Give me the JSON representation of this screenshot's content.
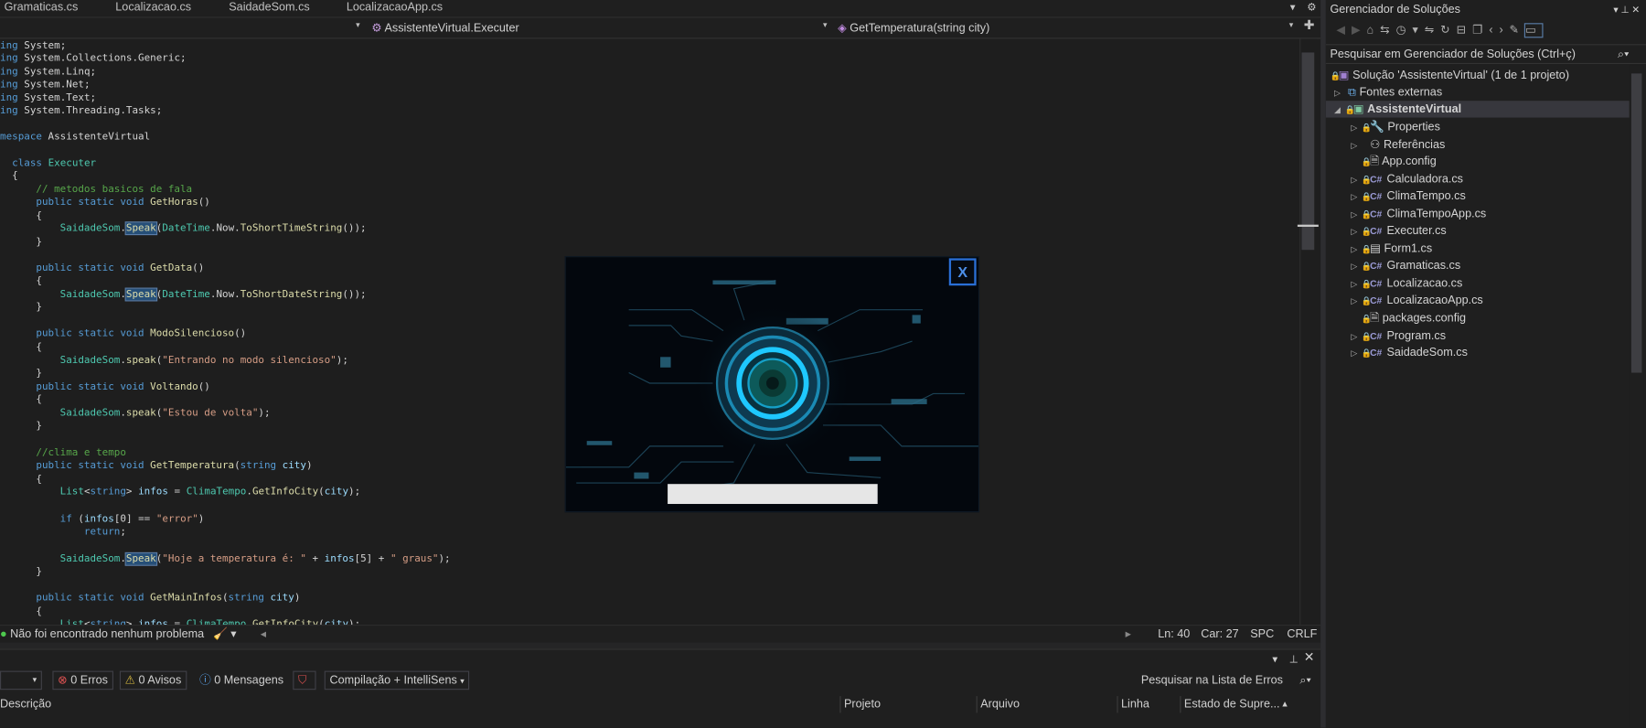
{
  "tabs": [
    {
      "label": "Gramaticas.cs"
    },
    {
      "label": "Localizacao.cs"
    },
    {
      "label": "SaidadeSom.cs"
    },
    {
      "label": "LocalizacaoApp.cs"
    }
  ],
  "tab_icons": {
    "dropdown": "▾",
    "settings": "⚙"
  },
  "navbar": {
    "class": "AssistenteVirtual.Executer",
    "method": "GetTemperatura(string city)"
  },
  "code": [
    {
      "kind": "using",
      "text": "ing System;"
    },
    {
      "kind": "using",
      "text": "ing System.Collections.Generic;"
    },
    {
      "kind": "using",
      "text": "ing System.Linq;"
    },
    {
      "kind": "using",
      "text": "ing System.Net;"
    },
    {
      "kind": "using",
      "text": "ing System.Text;"
    },
    {
      "kind": "using",
      "text": "ing System.Threading.Tasks;"
    },
    {
      "kind": "ns",
      "text": "mespace AssistenteVirtual"
    },
    {
      "kind": "class",
      "text": "class Executer"
    },
    {
      "kind": "comment",
      "text": "// metodos basicos de fala"
    },
    {
      "kind": "sig",
      "text": "public static void GetHoras()"
    },
    {
      "kind": "speak",
      "text": "SaidadeSom.Speak(DateTime.Now.ToShortTimeString());"
    },
    {
      "kind": "sig",
      "text": "public static void GetData()"
    },
    {
      "kind": "speak",
      "text": "SaidadeSom.Speak(DateTime.Now.ToShortDateString());"
    },
    {
      "kind": "sig",
      "text": "public static void ModoSilencioso()"
    },
    {
      "kind": "speak",
      "text": "SaidadeSom.speak(\"Entrando no modo silencioso\");"
    },
    {
      "kind": "sig",
      "text": "public static void Voltando()"
    },
    {
      "kind": "speak",
      "text": "SaidadeSom.speak(\"Estou de volta\");"
    },
    {
      "kind": "comment",
      "text": "//clima e tempo"
    },
    {
      "kind": "sig",
      "text": "public static void GetTemperatura(string city)"
    },
    {
      "kind": "stmt",
      "text": "List<string> infos = ClimaTempo.GetInfoCity(city);"
    },
    {
      "kind": "stmt",
      "text": "if (infos[0] == \"error\")"
    },
    {
      "kind": "stmt",
      "text": "return;"
    },
    {
      "kind": "speak",
      "text": "SaidadeSom.Speak(\"Hoje a temperatura é: \" + infos[5] + \" graus\");"
    },
    {
      "kind": "sig",
      "text": "public static void GetMainInfos(string city)"
    },
    {
      "kind": "stmt",
      "text": "List<string> infos = ClimaTempo.GetInfoCity(city);"
    },
    {
      "kind": "brace",
      "text": "{"
    },
    {
      "kind": "brace",
      "text": "}"
    }
  ],
  "status": {
    "problems": "Não foi encontrado nenhum problema",
    "line": "Ln: 40",
    "col": "Car: 27",
    "spacing": "SPC",
    "eol": "CRLF"
  },
  "errors": {
    "errors": "0 Erros",
    "warnings": "0 Avisos",
    "messages": "0 Mensagens",
    "scope": "Compilação + IntelliSens",
    "search": "Pesquisar na Lista de Erros",
    "columns": [
      "Descrição",
      "Projeto",
      "Arquivo",
      "Linha",
      "Estado de Supre..."
    ]
  },
  "solution": {
    "title": "Gerenciador de Soluções",
    "search": "Pesquisar em Gerenciador de Soluções (Ctrl+ç)",
    "root": "Solução 'AssistenteVirtual' (1 de 1 projeto)",
    "external": "Fontes externas",
    "project": "AssistenteVirtual",
    "items": [
      {
        "label": "Properties",
        "icon": "wrench-icon"
      },
      {
        "label": "Referências",
        "icon": "references-icon"
      },
      {
        "label": "App.config",
        "icon": "config-icon"
      },
      {
        "label": "Calculadora.cs",
        "icon": "csharp-icon"
      },
      {
        "label": "ClimaTempo.cs",
        "icon": "csharp-icon"
      },
      {
        "label": "ClimaTempoApp.cs",
        "icon": "csharp-icon"
      },
      {
        "label": "Executer.cs",
        "icon": "csharp-icon"
      },
      {
        "label": "Form1.cs",
        "icon": "form-icon"
      },
      {
        "label": "Gramaticas.cs",
        "icon": "csharp-icon"
      },
      {
        "label": "Localizacao.cs",
        "icon": "csharp-icon"
      },
      {
        "label": "LocalizacaoApp.cs",
        "icon": "csharp-icon"
      },
      {
        "label": "packages.config",
        "icon": "config-icon"
      },
      {
        "label": "Program.cs",
        "icon": "csharp-icon"
      },
      {
        "label": "SaidadeSom.cs",
        "icon": "csharp-icon"
      }
    ]
  },
  "modal": {
    "close": "X",
    "colors": {
      "core": "#1ec8ff",
      "glow": "#0a4a66",
      "circuit": "#1a3a4a"
    }
  }
}
